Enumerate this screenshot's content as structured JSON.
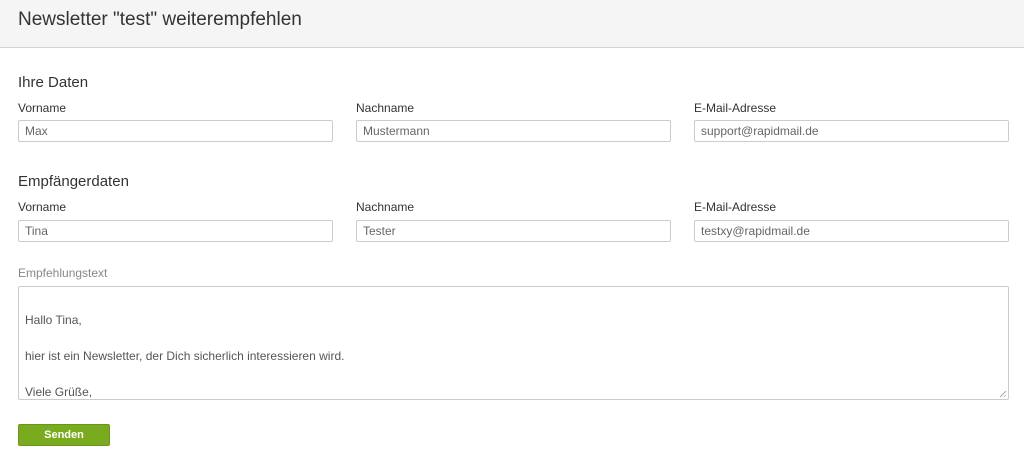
{
  "header": {
    "title": "Newsletter \"test\" weiterempfehlen"
  },
  "sender": {
    "section_title": "Ihre Daten",
    "firstname_label": "Vorname",
    "firstname_value": "Max",
    "lastname_label": "Nachname",
    "lastname_value": "Mustermann",
    "email_label": "E-Mail-Adresse",
    "email_value": "support@rapidmail.de"
  },
  "recipient": {
    "section_title": "Empfängerdaten",
    "firstname_label": "Vorname",
    "firstname_value": "Tina",
    "lastname_label": "Nachname",
    "lastname_value": "Tester",
    "email_label": "E-Mail-Adresse",
    "email_value": "testxy@rapidmail.de"
  },
  "message": {
    "label": "Empfehlungstext",
    "text": "Hallo Tina,\n\nhier ist ein Newsletter, der Dich sicherlich interessieren wird.\n\nViele Grüße,\nMax"
  },
  "actions": {
    "send_label": "Senden"
  },
  "colors": {
    "accent": "#7aab1f",
    "header_bg": "#f5f5f5"
  }
}
